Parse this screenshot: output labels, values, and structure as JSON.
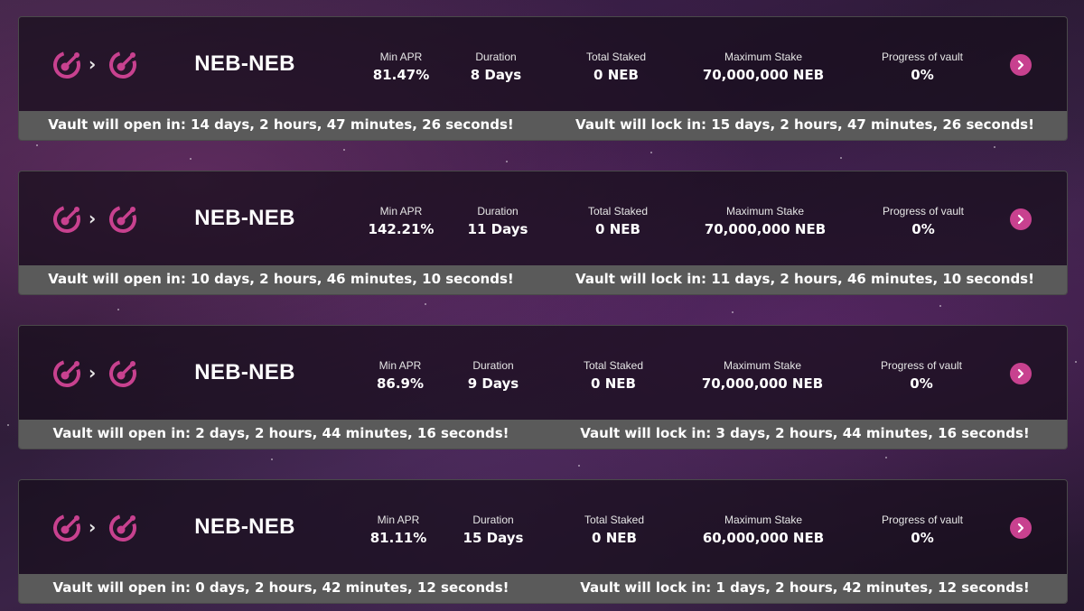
{
  "colors": {
    "accent": "#c8418f",
    "card": "#1a111e",
    "timer_bar": "#5a5a5a"
  },
  "icons": {
    "token": "neb-token-icon",
    "pair_arrow": "chevron-right-icon",
    "open": "chevron-right-icon"
  },
  "labels": {
    "min_apr": "Min APR",
    "duration": "Duration",
    "total_staked": "Total Staked",
    "maximum_stake": "Maximum Stake",
    "progress": "Progress of vault"
  },
  "pair_arrow": "›",
  "vaults": [
    {
      "pair": "NEB-NEB",
      "min_apr": "81.47%",
      "duration": "8 Days",
      "total_staked": "0 NEB",
      "maximum_stake": "70,000,000 NEB",
      "progress": "0%",
      "open_text": "Vault will open in: 14 days, 2 hours, 47 minutes, 26 seconds!",
      "lock_text": "Vault will lock in: 15 days, 2 hours, 47 minutes, 26 seconds!"
    },
    {
      "pair": "NEB-NEB",
      "min_apr": "142.21%",
      "duration": "11 Days",
      "total_staked": "0 NEB",
      "maximum_stake": "70,000,000 NEB",
      "progress": "0%",
      "open_text": "Vault will open in: 10 days, 2 hours, 46 minutes, 10 seconds!",
      "lock_text": "Vault will lock in: 11 days, 2 hours, 46 minutes, 10 seconds!"
    },
    {
      "pair": "NEB-NEB",
      "min_apr": "86.9%",
      "duration": "9 Days",
      "total_staked": "0 NEB",
      "maximum_stake": "70,000,000 NEB",
      "progress": "0%",
      "open_text": "Vault will open in: 2 days, 2 hours, 44 minutes, 16 seconds!",
      "lock_text": "Vault will lock in: 3 days, 2 hours, 44 minutes, 16 seconds!"
    },
    {
      "pair": "NEB-NEB",
      "min_apr": "81.11%",
      "duration": "15 Days",
      "total_staked": "0 NEB",
      "maximum_stake": "60,000,000 NEB",
      "progress": "0%",
      "open_text": "Vault will open in: 0 days, 2 hours, 42 minutes, 12 seconds!",
      "lock_text": "Vault will lock in: 1 days, 2 hours, 42 minutes, 12 seconds!"
    }
  ]
}
